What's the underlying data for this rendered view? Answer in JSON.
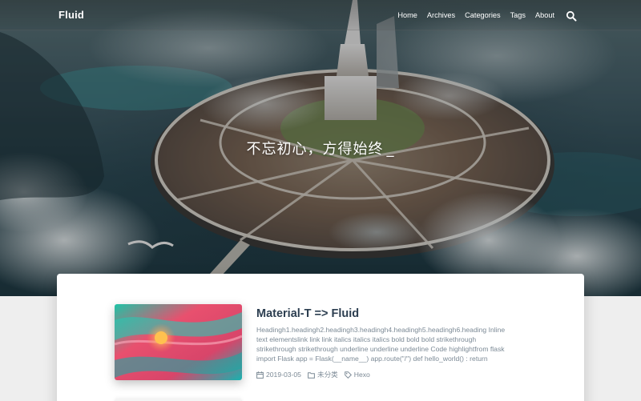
{
  "navbar": {
    "brand": "Fluid",
    "items": [
      {
        "label": "Home"
      },
      {
        "label": "Archives"
      },
      {
        "label": "Categories"
      },
      {
        "label": "Tags"
      },
      {
        "label": "About"
      }
    ],
    "search_icon": "search-icon"
  },
  "banner": {
    "slogan": "不忘初心，方得始终",
    "cursor": "_"
  },
  "post": {
    "title": "Material-T => Fluid",
    "excerpt": "Headingh1.headingh2.headingh3.headingh4.headingh5.headingh6.heading Inline text elementslink link link italics italics italics bold bold bold strikethrough strikethrough strikethrough underline underline underline Code highlightfrom flask import Flask app = Flask(__name__) app.route(\"/\") def hello_world() : return",
    "date": "2019-03-05",
    "category": "未分类",
    "tag": "Hexo",
    "icons": {
      "date": "calendar-icon",
      "category": "folder-icon",
      "tag": "tag-icon"
    }
  },
  "colors": {
    "title": "#2c3e50",
    "meta": "#7c8a96",
    "page_bg": "#eeeeee",
    "card_bg": "#ffffff"
  }
}
